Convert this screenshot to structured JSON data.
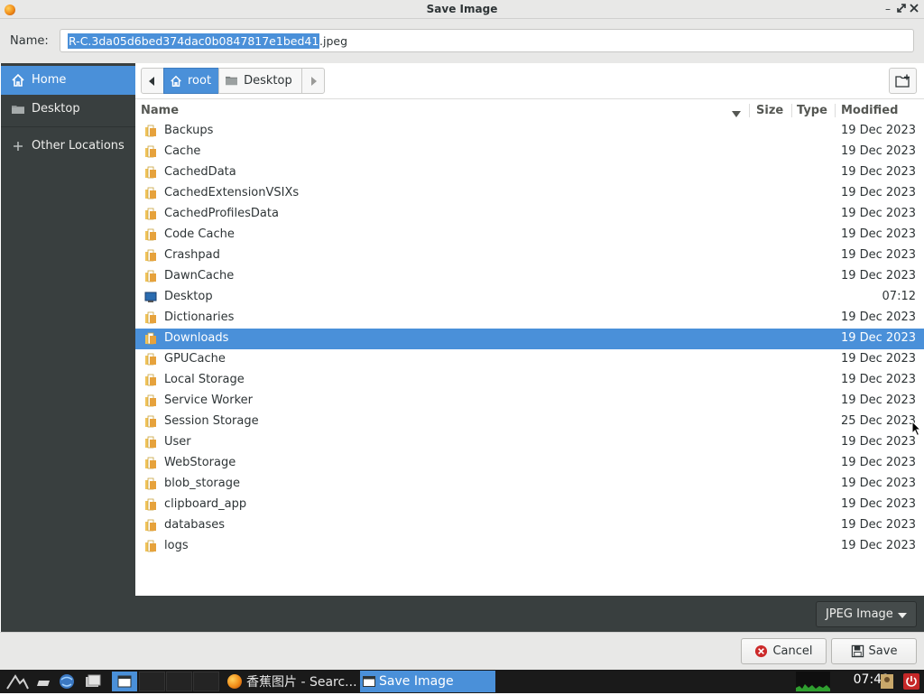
{
  "window": {
    "title": "Save Image"
  },
  "name_row": {
    "label": "Name:",
    "selected_text": "R-C.3da05d6bed374dac0b0847817e1bed41",
    "extension": ".jpeg"
  },
  "sidebar": {
    "items": [
      {
        "label": "Home",
        "icon": "home-icon",
        "active": true
      },
      {
        "label": "Desktop",
        "icon": "folder-icon",
        "active": false
      },
      {
        "label": "Other Locations",
        "icon": "plus-icon",
        "active": false
      }
    ]
  },
  "pathbar": {
    "segments": [
      "root",
      "Desktop"
    ]
  },
  "columns": {
    "name": "Name",
    "size": "Size",
    "type": "Type",
    "modified": "Modified"
  },
  "files": [
    {
      "name": "Backups",
      "modified": "19 Dec 2023"
    },
    {
      "name": "Cache",
      "modified": "19 Dec 2023"
    },
    {
      "name": "CachedData",
      "modified": "19 Dec 2023"
    },
    {
      "name": "CachedExtensionVSIXs",
      "modified": "19 Dec 2023"
    },
    {
      "name": "CachedProfilesData",
      "modified": "19 Dec 2023"
    },
    {
      "name": "Code Cache",
      "modified": "19 Dec 2023"
    },
    {
      "name": "Crashpad",
      "modified": "19 Dec 2023"
    },
    {
      "name": "DawnCache",
      "modified": "19 Dec 2023"
    },
    {
      "name": "Desktop",
      "modified": "07:12"
    },
    {
      "name": "Dictionaries",
      "modified": "19 Dec 2023"
    },
    {
      "name": "Downloads",
      "modified": "19 Dec 2023",
      "selected": true
    },
    {
      "name": "GPUCache",
      "modified": "19 Dec 2023"
    },
    {
      "name": "Local Storage",
      "modified": "19 Dec 2023"
    },
    {
      "name": "Service Worker",
      "modified": "19 Dec 2023"
    },
    {
      "name": "Session Storage",
      "modified": "25 Dec 2023"
    },
    {
      "name": "User",
      "modified": "19 Dec 2023"
    },
    {
      "name": "WebStorage",
      "modified": "19 Dec 2023"
    },
    {
      "name": "blob_storage",
      "modified": "19 Dec 2023"
    },
    {
      "name": "clipboard_app",
      "modified": "19 Dec 2023"
    },
    {
      "name": "databases",
      "modified": "19 Dec 2023"
    },
    {
      "name": "logs",
      "modified": "19 Dec 2023"
    }
  ],
  "filter": {
    "label": "JPEG Image"
  },
  "buttons": {
    "cancel": "Cancel",
    "save": "Save"
  },
  "taskbar": {
    "tasks": [
      {
        "label": "香蕉图片 - Searc...",
        "active": false
      },
      {
        "label": "Save Image",
        "active": true
      }
    ],
    "clock": "07:41"
  },
  "colors": {
    "accent": "#4a90d9",
    "sidebar_bg": "#393f3f",
    "folder": "#e6a23c"
  }
}
